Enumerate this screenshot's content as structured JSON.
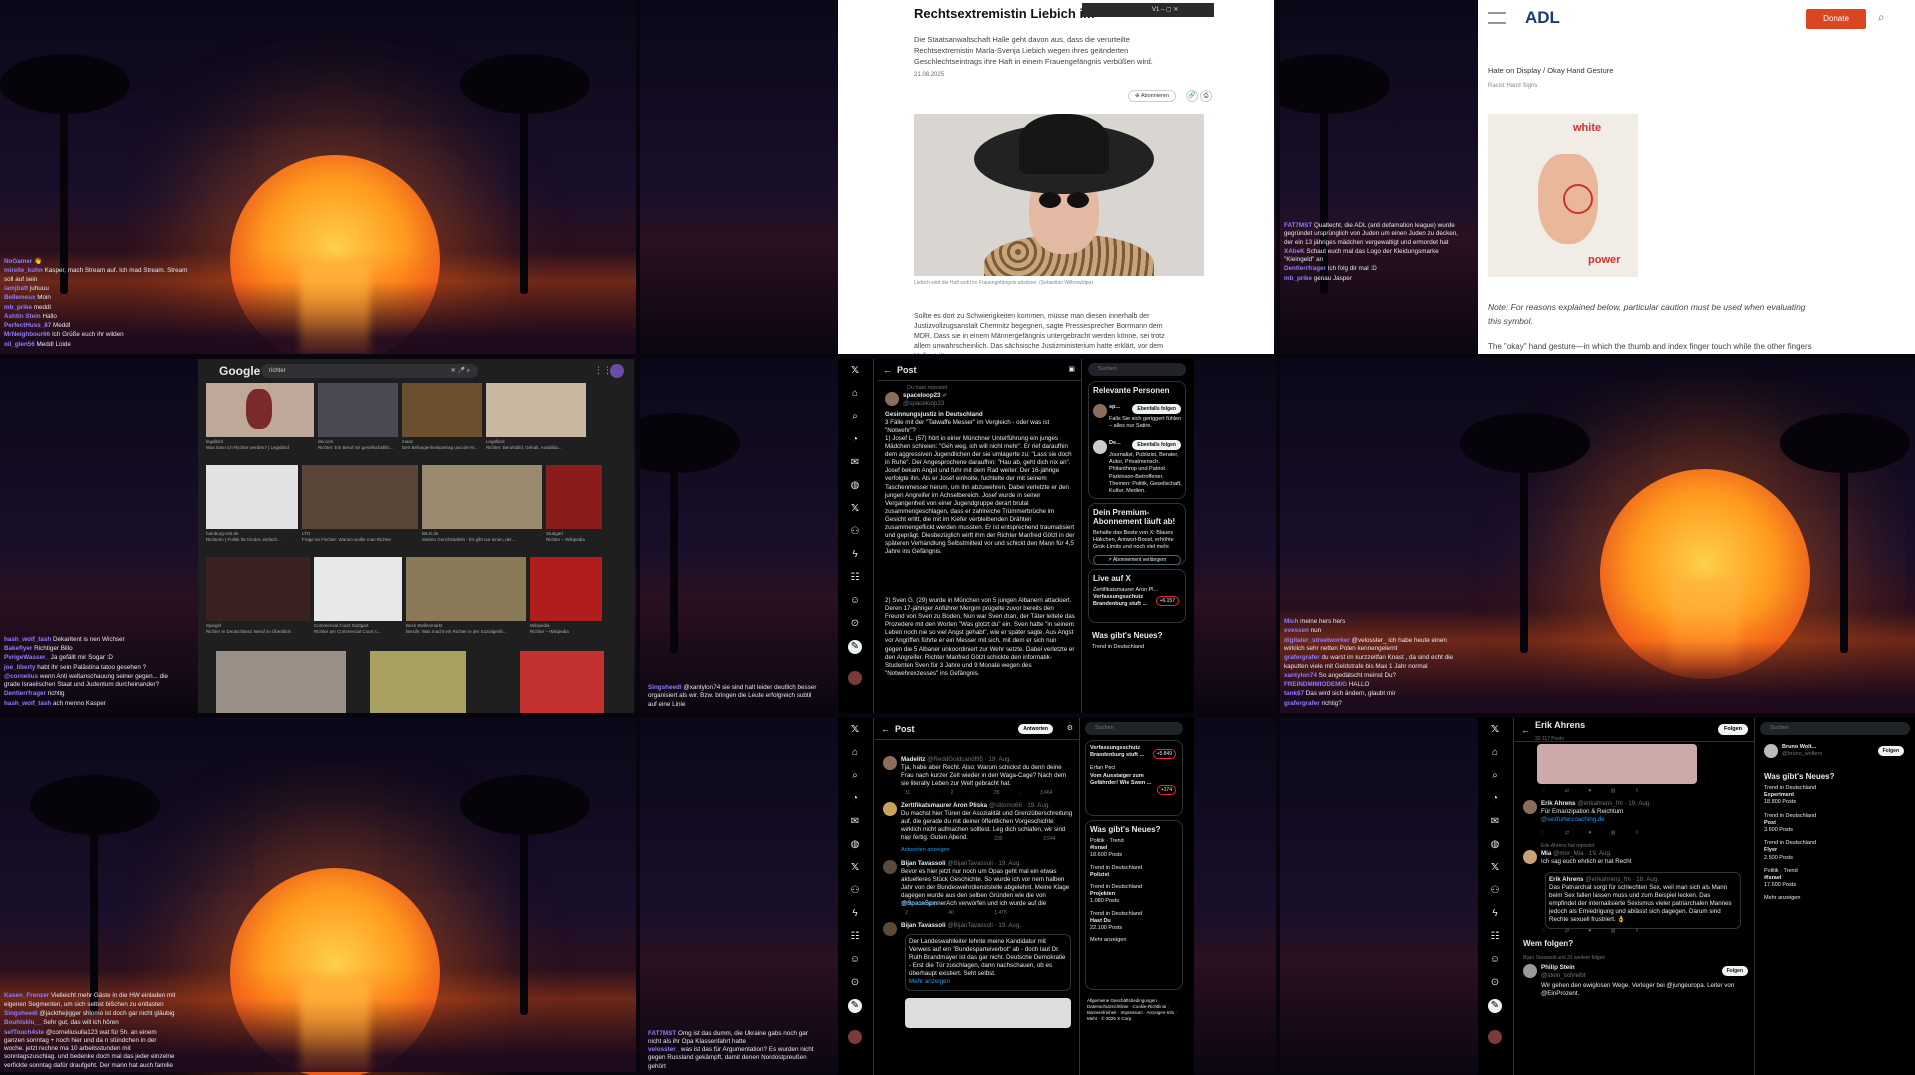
{
  "tile1": {
    "chat": [
      {
        "user": "NoGamer",
        "text": "👋"
      },
      {
        "user": "mirelle_kuhn",
        "text": "Kasper, mach Stream auf. Ich mad Stream. Stream soll auf sein"
      },
      {
        "user": "iamjbatt",
        "text": "juhuuu"
      },
      {
        "user": "Bellemeux",
        "text": "Moin"
      },
      {
        "user": "mb_prike",
        "text": "meddl"
      },
      {
        "user": "Ashtin Stein",
        "text": "Hallo"
      },
      {
        "user": "PerfectHuss_87",
        "text": "Meddl"
      },
      {
        "user": "MrNeighbour66",
        "text": "Ich Grüße euch ihr wilden"
      },
      {
        "user": "oil_glen56",
        "text": "Meddl Loide"
      }
    ]
  },
  "tile2": {
    "mini_toolbar": "V1",
    "headline": "Rechtsextremistin Liebich im",
    "lead": "Die Staatsanwaltschaft Halle geht davon aus, dass die verurteilte Rechtsextremistin Marla-Svenja Liebich wegen ihres geänderten Geschlechtseintrags ihre Haft in einem Frauengefängnis verbüßen wird.",
    "date": "21.08.2025",
    "share_label": "Abonnieren",
    "caption": "Liebich wird die Haft wohl im Frauengefängnis absitzen. (Sebastian Willnow/dpa)",
    "body": "Sollte es dort zu Schwierigkeiten kommen, müsse man diesen innerhalb der Justizvollzugsanstalt Chemnitz begegnen, sagte Pressesprecher Borrmann dem MDR. Dass sie in einem Männergefängnis untergebracht werden könne, sei trotz allem unwahrscheinlich. Das sächsische Justizministerium hatte erklärt, vor dem Haftantritt"
  },
  "tile3": {
    "logo": "ADL",
    "donate": "Donate",
    "breadcrumb": "Hate on Display / Okay Hand Gesture",
    "subtitle": "Racist Hand Signs",
    "img_top": "white",
    "img_bottom": "power",
    "note": "Note: For reasons explained below, particular caution must be used when evaluating this symbol.",
    "cut": "The \"okay\" hand gesture—in which the thumb and index finger touch while the other fingers",
    "chat": [
      {
        "user": "FAT7MST",
        "text": "Qualtecht, die ADL (anti defamation league) wurde gegründet ursprünglich von Juden um einen Juden zu decken, der ein 13 jähriges mädchen vergewaltigt und ermordet hat"
      },
      {
        "user": "XAbeK",
        "text": "Schaut euch mal das Logo der Kleidungsmarke \"Kleingeld\" an"
      },
      {
        "user": "Dentlerrfrager",
        "text": "Ich folg dir mal :D"
      },
      {
        "user": "mb_prike",
        "text": "genau Jasper"
      }
    ]
  },
  "tile4": {
    "logo": "Google",
    "query": "richter",
    "images": [
      {
        "src": "legalbird",
        "cap": "Was kann ich Richter werden? | Legalbird"
      },
      {
        "src": "dw.com",
        "cap": "Richter: Ein Beruf mit gesellschaftlic..."
      },
      {
        "src": "maaz",
        "cap": "Den Befangenheitsantrag und die M..."
      },
      {
        "src": "Legalbird",
        "cap": "Richter: Berufsbild, Gehalt, Ausbildu..."
      },
      {
        "src": "hamburg-zeit.de",
        "cap": "Richterin | Politik für Kinder, einfach..."
      },
      {
        "src": "LTO",
        "cap": "Frage an Fischer: Warum wollte man Richter"
      },
      {
        "src": "BILD.de",
        "cap": "Sieben Gerichtstafeln - Es gibt nur einen, der..."
      },
      {
        "src": "Stuttgart",
        "cap": "Richter – Wikipedia"
      },
      {
        "src": "Spiegel",
        "cap": "Richter In Deutschland: Beruf im Überblick"
      },
      {
        "src": "Commercial Court Stuttgart",
        "cap": "Richter am Commercial Court s..."
      },
      {
        "src": "Beck Stellenmarkt",
        "cap": "Berufe: Was macht ein Richter in der Sozialgerib..."
      },
      {
        "src": "Wikipedia",
        "cap": "Richter – Wikipedia"
      }
    ],
    "chat": [
      {
        "user": "hash_wolf_tash",
        "text": "Dekaritent is nen Wichser"
      },
      {
        "user": "Bakeflyer",
        "text": "Richtiger Billo"
      },
      {
        "user": "PvrigeWasser_",
        "text": "Ja gefällt mir Sogar :D"
      },
      {
        "user": "joe_liberty",
        "text": "habt ihr sein Palästina tatoo gesehen ?"
      },
      {
        "user": "@cornelius",
        "text": "wenn Anti weltanschauung seiner gegen... die grade Israelischen Staat und Judentum durcheinander?"
      },
      {
        "user": "Dentlerrfrager",
        "text": "richtig"
      },
      {
        "user": "hash_wolf_tash",
        "text": "ach menno Kasper"
      }
    ]
  },
  "tile5": {
    "chat": [
      {
        "user": "Singsheedi",
        "text": "@xantylon74 sie sind halt leider deutlich besser organisiert als wir. Bzw. bringen die Leute erfolgreich subtil auf eine Linie"
      }
    ]
  },
  "tile6": {
    "header": "Post",
    "reposted": "Du hast repostet",
    "author": "spaceloop23",
    "handle": "@spaceloop23",
    "title": "Gesinnungsjustiz in Deutschland",
    "subtitle": "3 Fälle mit der \"Tatwaffe Messer\" im Vergleich - oder was ist \"Notwehr\"?",
    "p1": "1) Josef L. (57) hört in einer Münchner Unterführung ein junges Mädchen schreien: \"Geh weg, ich will nicht mehr\". Er rief daraufhin dem aggressiven Jugendlichen der sie umlagerte zu: \"Lass sie doch in Ruhe\". Der Angesprochene daraufhin: \"Hau ab, geht dich nix an\". Josef bekam Angst und fuhr mit dem Rad weiter. Der 16-jährige verfolgte ihn. Als er Josef einholte, fuchtelte der mit seinem Taschenmesser herum, um ihn abzuwehren. Dabei verletzte er den jungen Angreifer im Achselbereich. Josef wurde in seiner Vergangenheit von einer Jugendgruppe derart brutal zusammengeschlagen, dass er zahlreiche Trümmerbrüche im Gesicht erlitt, die mit im Kiefer verbleibenden Drähten zusammengeflickt werden mussten. Er ist entsprechend traumatisiert und geprägt. Diesbezüglich wirft ihm der Richter Manfred Götzl in der späteren Verhandlung Selbstmitleid vor und schickt den Mann für 4,5 Jahre ins Gefängnis.",
    "p2": "2) Sven G. (29) wurde in München von 5 jungen Albanern attackiert. Deren 17-jähriger Anführer Mergim prügelte zuvor bereits den Freund von Sven zu Boden. Nun war Sven dran, der Täter leitete das Prozedere mit den Worten \"Was glotzt du\" ein. Sven hatte \"in seinem Leben noch nie so viel Angst gehabt\", wie er später sagte. Aus Angst vor Angriffen führte er ein Messer mit sich, mit dem er sich nun gegen die 5 Albaner unkoordiniert zur Wehr setzte. Dabei verletzte er den Angreifer. Richter Manfred Götzl schickte den informatik-Studenten Sven für 3 Jahre und 9 Monate wegen des \"Notwehrexzesses\" ins Gefängnis.",
    "search": "Suchen",
    "relevant_title": "Relevante Personen",
    "person1_name": "sp...",
    "person1_desc": "Falls Sie sich geriggert fühlen – alles nur Satire.",
    "person2_name": "De...",
    "person2_desc": "Journalist, Publizist, Berater, Autor, Privatmensch. Philanthrop und Patriot. Parkinson-Betroffener. Themen: Politik, Gesellschaft, Kultur, Medien.",
    "follow_label": "Ebenfalls folgen",
    "premium_title": "Dein Premium-Abonnement läuft ab!",
    "premium_text": "Behalte das Beste von X: Blaues Häkchen, Antwort-Boost, erhöhte Grok-Limits und noch viel mehr.",
    "premium_button": "Abonnement verlängern",
    "live_title": "Live auf X",
    "live_name": "Zertifikatsmaurer Aron Pl...",
    "live_topic": "Verfassungsschutz Brandenburg stuft ...",
    "live_count": "+6.157",
    "news_title": "Was gibt's Neues?",
    "news_sub": "Trend in Deutschland"
  },
  "tile7": {
    "chat": [
      {
        "user": "Mich",
        "text": "meine hers hers"
      },
      {
        "user": "evessen",
        "text": "nun"
      },
      {
        "user": "digitaler_streetworker",
        "text": "@velosster_ ich habe heute einen wirklich sehr netten Polen kennengelernt"
      },
      {
        "user": "grafergrafer",
        "text": "du warst im kurzzeitfan Knast , da sind echt die kaputten viele mit Geldstrafe bis Max 1 Jahr normal"
      },
      {
        "user": "xantylon74",
        "text": "So angedätscht meinst Du?"
      },
      {
        "user": "FREINDMIMIODEMIG",
        "text": "HALLO"
      },
      {
        "user": "tank67",
        "text": "Das wird sich ändern, glaubt mir"
      },
      {
        "user": "grafergrafer",
        "text": "richtig?"
      }
    ]
  },
  "tile8": {
    "chat": [
      {
        "user": "Kasen_Frenzer",
        "text": "Vielleicht mehr Gäste in die HW einladen mit eigenen Segmenten, um sich selbst bißchen zu entlasten"
      },
      {
        "user": "Singsheedi",
        "text": "@jackthejigger shlomo ist doch gar nicht gläubig"
      },
      {
        "user": "Bouhlsklu__",
        "text": "Sehr gut, das will ich hören"
      },
      {
        "user": "sefTouch4ste",
        "text": "@corneliusulla123 wat für 5h. an einem ganzen sonntag + noch hier und da n stündchen in der woche. jetzt rechne ma 10 arbeitsstunden mit sonntagszuschlag. und bedenke doch mal das jeder einzelne verfickte sonntag dafür draufgeht. Der mann hat auch familie"
      }
    ]
  },
  "tile9": {
    "chat": [
      {
        "user": "FAT7MST",
        "text": "Omg ist das dumm, die Ukraine gabs noch gar nicht als ihr Opa Klassenfahrt hatte"
      },
      {
        "user": "velosster_",
        "text": "was ist das für Argumentation? Es wurden nicht gegen Russland gekämpft, damit denen Nordostpreußen gehört"
      }
    ]
  },
  "tile10": {
    "header": "Post",
    "reply_button": "Antworten",
    "replies": [
      {
        "name": "Madelitz",
        "handle": "@ReddGoldcandl95 · 19. Aug.",
        "text": "Tja, habe aber Recht. Also: Warum schickst du denn deine Frau nach kurzer Zeit wieder in den Waga-Cage? Nach dem sie literally Leben zur Welt gebracht hat.",
        "stats": "11 · 2 · 35 · 3.464"
      },
      {
        "name": "Zertifikatsmaurer Aron Pliska",
        "handle": "@stitomo66 · 19. Aug.",
        "text": "Du machst hier Türen der Asozialität und Grenzüberschreitung auf, die gerade du mit deiner öffentlichen Vorgeschichte wirklich nicht aufmachen solltest. Leg dich schlafen, wir sind hier fertig. Guten Abend.",
        "stats": "12 · 1 · 230 · 3.544"
      },
      {
        "name": "Bijan Tavassoli",
        "handle": "@BijanTavassoli · 19. Aug.",
        "text": "Bevor es hier jetzt nur noch um Opas geht mal ein etwas aktuelleres Stück Geschichte. So wurde ich vor nem halben Jahr von der Bundeswehrdienststelle abgelehnt. Meine Klage dagegen wurde aus den selben Gründen wie die von @SpaceSpinnerAch verworfen und ich wurde auf die",
        "stats": "2 · 40 · 1.475"
      },
      {
        "name": "Bijan Tavassoli",
        "handle": "@BijanTavassoli · 19. Aug.",
        "text": "Der Landeswahlleiter lehnte meine Kandidatur mit Verweis auf ein \"Bundesparteiverbot\" ab - doch laut Dr. Ruth Brandmayer ist das gar nicht. Deutsche Demokratie - Erst die Tür zuschlagen, dann nachschauen, ob es überhaupt existiert. Seht selbst.",
        "stats": ""
      }
    ],
    "show_answers": "Antworten anzeigen",
    "more": "Mehr anzeigen",
    "search": "Suchen",
    "live_topic": "Verfassungsschutz Brandenburg stuft ...",
    "live_count1": "+5.849",
    "live_name2": "Erfan Peci",
    "live_topic2": "Vom Ausstaiger zum Gefährder! Wie Swen ...",
    "live_count2": "+174",
    "news_title": "Was gibt's Neues?",
    "trends": [
      {
        "ctx": "Politik · Trend",
        "tag": "#Israel",
        "posts": "18.600 Posts"
      },
      {
        "ctx": "Trend in Deutschland",
        "tag": "Polizist",
        "posts": ""
      },
      {
        "ctx": "Trend in Deutschland",
        "tag": "Projekten",
        "posts": "1.080 Posts"
      },
      {
        "ctx": "Trend in Deutschland",
        "tag": "Hast Du",
        "posts": "22.100 Posts"
      }
    ],
    "more_link": "Mehr anzeigen",
    "footer": "Allgemeine Geschäftsbedingungen · Datenschutzrichtlinie · Cookie-Richtlinie · Barrierefreiheit · Impressum · Anzeigen-Info · Mehr · © 2025 X Corp."
  },
  "tile11": {
    "header": "Erik Ahrens",
    "posts": "32.117 Posts",
    "follow": "Folgen",
    "post1_name": "Erik Ahrens",
    "post1_handle": "@erikahrens_fm · 19. Aug.",
    "post1_text": "Für Emanzipation & Reichtum",
    "post1_link": "@sexfurtercoaching.de",
    "repost_note": "Erik Ahrens hat repostet",
    "post2_name": "Mia",
    "post2_handle": "@mor_Mia · 19. Aug.",
    "post2_text": "Ich sag euch ehrlich er hat Recht",
    "quote_name": "Erik Ahrens",
    "quote_handle": "@erikahrens_fm · 18. Aug.",
    "quote_text": "Das Patriarchat sorgt für schlechten Sex, weil man sich als Mann beim Sex fallen lassen muss und zum Beispiel lecken. Das empfindet der internalisierte Sexismus vieler patriarchalen Mannes jedoch als Erniedrigung und ablässt sich dagegen. Darum sind Rechte sexuell frustriert. 👌",
    "who_title": "Wem folgen?",
    "who_sub": "Bijan Tavassoli und 31 weitere folgen",
    "who_name": "Philip Stein",
    "who_handle": "@stein_schreibt",
    "who_text": "Wir gehen den ewiglosen Wege. Verleger bei @jungeuropa. Leiter von @EinProzent.",
    "search": "Suchen",
    "suggest_name": "Bruno Wolt...",
    "suggest_handle": "@bruno_wolters",
    "news_title": "Was gibt's Neues?",
    "trends": [
      {
        "ctx": "Trend in Deutschland",
        "tag": "Experiment",
        "posts": "18.800 Posts"
      },
      {
        "ctx": "Trend in Deutschland",
        "tag": "Post",
        "posts": "3.600 Posts"
      },
      {
        "ctx": "Trend in Deutschland",
        "tag": "Flyer",
        "posts": "2.500 Posts"
      },
      {
        "ctx": "Politik · Trend",
        "tag": "#Israel",
        "posts": "17.600 Posts"
      }
    ],
    "more_link": "Mehr anzeigen"
  },
  "colors": {
    "x_bg": "#000000",
    "x_text": "#e7e9ea",
    "x_blue": "#1d9bf0",
    "adl_red": "#d9461f",
    "chat_name": "#8f7dff"
  },
  "icons": [
    "x-logo-icon",
    "home-icon",
    "search-icon",
    "bell-icon",
    "mail-icon",
    "grok-icon",
    "bookmark-icon",
    "people-icon",
    "lightning-icon",
    "profile-icon",
    "more-icon",
    "compose-icon"
  ]
}
